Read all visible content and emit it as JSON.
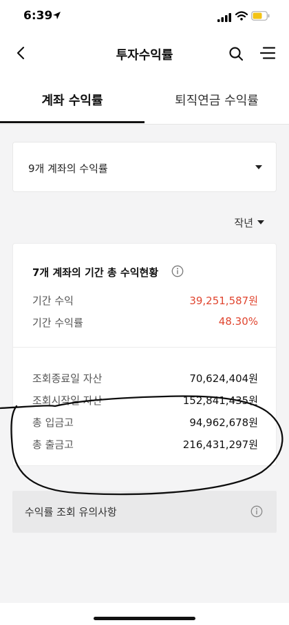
{
  "status_bar": {
    "time": "6:39"
  },
  "header": {
    "title": "투자수익률"
  },
  "tabs": [
    {
      "label": "계좌 수익률",
      "active": true
    },
    {
      "label": "퇴직연금 수익률",
      "active": false
    }
  ],
  "account_selector": {
    "value": "9개 계좌의 수익률"
  },
  "period_filter": {
    "value": "작년"
  },
  "summary": {
    "title": "7개 계좌의 기간 총 수익현황",
    "rows": [
      {
        "label": "기간 수익",
        "value": "39,251,587원"
      },
      {
        "label": "기간 수익률",
        "value": "48.30%"
      }
    ],
    "assets": [
      {
        "label": "조회종료일 자산",
        "value": "70,624,404원"
      },
      {
        "label": "조회시작일 자산",
        "value": "152,841,435원"
      },
      {
        "label": "총 입금고",
        "value": "94,962,678원"
      },
      {
        "label": "총 출금고",
        "value": "216,431,297원"
      }
    ]
  },
  "notice": {
    "label": "수익률 조회 유의사항"
  },
  "colors": {
    "accent_red": "#e0452f",
    "text": "#222222",
    "background": "#f4f4f5"
  }
}
